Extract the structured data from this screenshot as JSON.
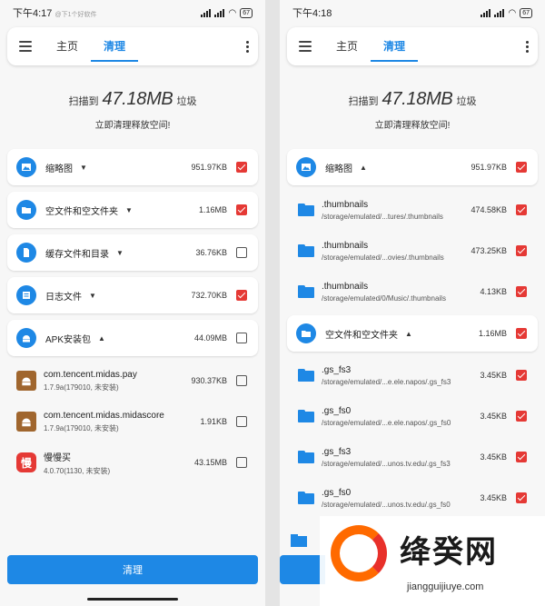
{
  "left": {
    "status": {
      "time": "下午4:17",
      "note": "@下1个好软件",
      "battery": "67"
    },
    "tabs": [
      "主页",
      "清理"
    ],
    "summary": {
      "prefix": "扫描到",
      "size": "47.18MB",
      "suffix": "垃圾",
      "subtitle": "立即清理释放空间!"
    },
    "categories": [
      {
        "label": "缩略图",
        "size": "951.97KB",
        "checked": true,
        "expanded": false
      },
      {
        "label": "空文件和空文件夹",
        "size": "1.16MB",
        "checked": true,
        "expanded": false
      },
      {
        "label": "缓存文件和目录",
        "size": "36.76KB",
        "checked": false,
        "expanded": false
      },
      {
        "label": "日志文件",
        "size": "732.70KB",
        "checked": true,
        "expanded": false
      },
      {
        "label": "APK安装包",
        "size": "44.09MB",
        "checked": false,
        "expanded": true
      }
    ],
    "apks": [
      {
        "name": "com.tencent.midas.pay",
        "sub": "1.7.9a(179010, 未安装)",
        "size": "930.37KB",
        "checked": false
      },
      {
        "name": "com.tencent.midas.midascore",
        "sub": "1.7.9a(179010, 未安装)",
        "size": "1.91KB",
        "checked": false
      },
      {
        "name": "慢慢买",
        "sub": "4.0.70(1130, 未安装)",
        "size": "43.15MB",
        "checked": false,
        "icon_text": "慢"
      }
    ],
    "clean_button": "清理"
  },
  "right": {
    "status": {
      "time": "下午4:18",
      "battery": "67"
    },
    "tabs": [
      "主页",
      "清理"
    ],
    "summary": {
      "prefix": "扫描到",
      "size": "47.18MB",
      "suffix": "垃圾",
      "subtitle": "立即清理释放空间!"
    },
    "cat1": {
      "label": "缩略图",
      "size": "951.97KB",
      "checked": true
    },
    "thumbs": [
      {
        "name": ".thumbnails",
        "path": "/storage/emulated/...tures/.thumbnails",
        "size": "474.58KB",
        "checked": true
      },
      {
        "name": ".thumbnails",
        "path": "/storage/emulated/...ovies/.thumbnails",
        "size": "473.25KB",
        "checked": true
      },
      {
        "name": ".thumbnails",
        "path": "/storage/emulated/0/Music/.thumbnails",
        "size": "4.13KB",
        "checked": true
      }
    ],
    "cat2": {
      "label": "空文件和空文件夹",
      "size": "1.16MB",
      "checked": true
    },
    "empties": [
      {
        "name": ".gs_fs3",
        "path": "/storage/emulated/...e.ele.napos/.gs_fs3",
        "size": "3.45KB",
        "checked": true
      },
      {
        "name": ".gs_fs0",
        "path": "/storage/emulated/...e.ele.napos/.gs_fs0",
        "size": "3.45KB",
        "checked": true
      },
      {
        "name": ".gs_fs3",
        "path": "/storage/emulated/...unos.tv.edu/.gs_fs3",
        "size": "3.45KB",
        "checked": true
      },
      {
        "name": ".gs_fs0",
        "path": "/storage/emulated/...unos.tv.edu/.gs_fs0",
        "size": "3.45KB",
        "checked": true
      }
    ]
  },
  "watermark": {
    "title": "绛癸网",
    "url": "jiangguijiuye.com"
  },
  "colors": {
    "accent": "#1e88e5",
    "check": "#e53935"
  }
}
